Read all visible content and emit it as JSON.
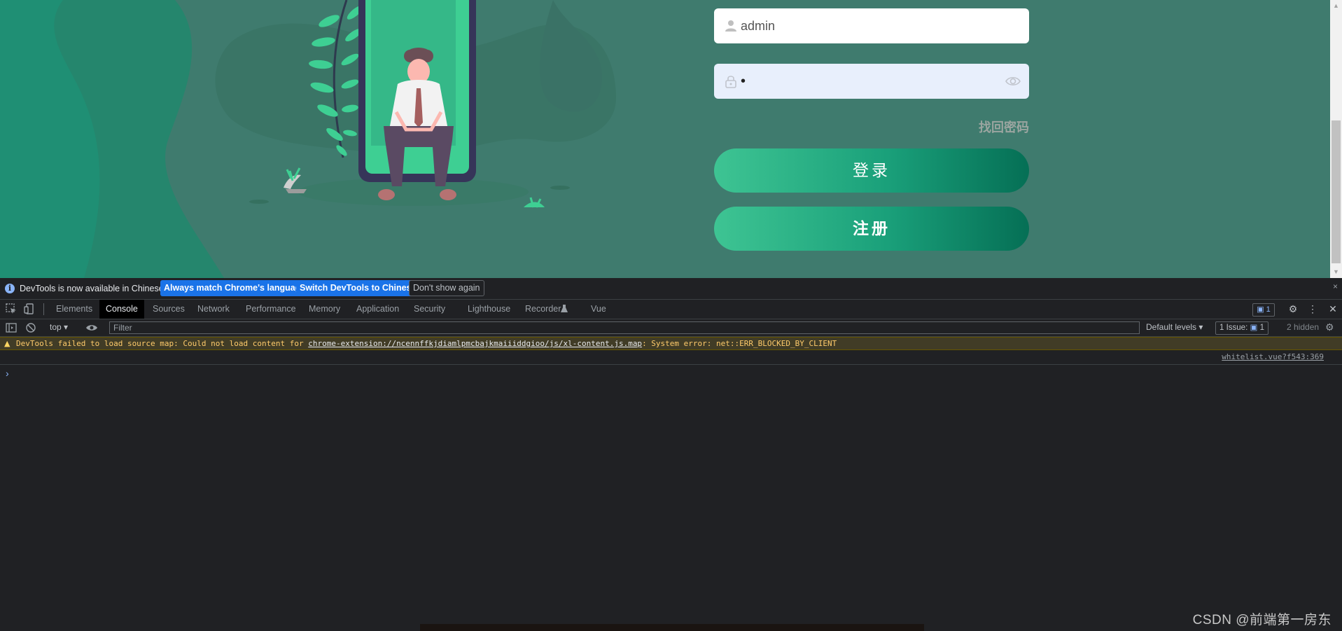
{
  "login": {
    "username_value": "admin",
    "password_value": "•",
    "forgot_label": "找回密码",
    "login_label": "登录",
    "register_label": "注册"
  },
  "devtools": {
    "infobar": {
      "message": "DevTools is now available in Chinese!",
      "btn_match": "Always match Chrome's language",
      "btn_switch": "Switch DevTools to Chinese",
      "btn_dismiss": "Don't show again",
      "close": "×"
    },
    "tabs": [
      "Elements",
      "Console",
      "Sources",
      "Network",
      "Performance",
      "Memory",
      "Application",
      "Security",
      "Lighthouse",
      "Recorder",
      "Vue"
    ],
    "active_tab": "Console",
    "issues_badge": "1",
    "console_bar": {
      "context": "top",
      "filter_placeholder": "Filter",
      "levels": "Default levels",
      "issues": "1 Issue:",
      "issues_count": "1",
      "hidden": "2 hidden"
    },
    "warning": {
      "prefix": "DevTools failed to load source map: Could not load content for ",
      "link": "chrome-extension://ncennffkjdiamlpmcbajkmaiiiddgioo/js/xl-content.js.map",
      "suffix": ": System error: net::ERR_BLOCKED_BY_CLIENT"
    },
    "source_link": "whitelist.vue?f543:369",
    "prompt": "›"
  },
  "watermark": "CSDN @前端第一房东",
  "colors": {
    "page_bg": "#3f7b6e",
    "button_start": "#3ec493",
    "button_end": "#056f55",
    "devtools_bg": "#202124",
    "warning_bg": "#413c26",
    "warning_text": "#ffcb6b",
    "accent_blue": "#1a73e8"
  }
}
